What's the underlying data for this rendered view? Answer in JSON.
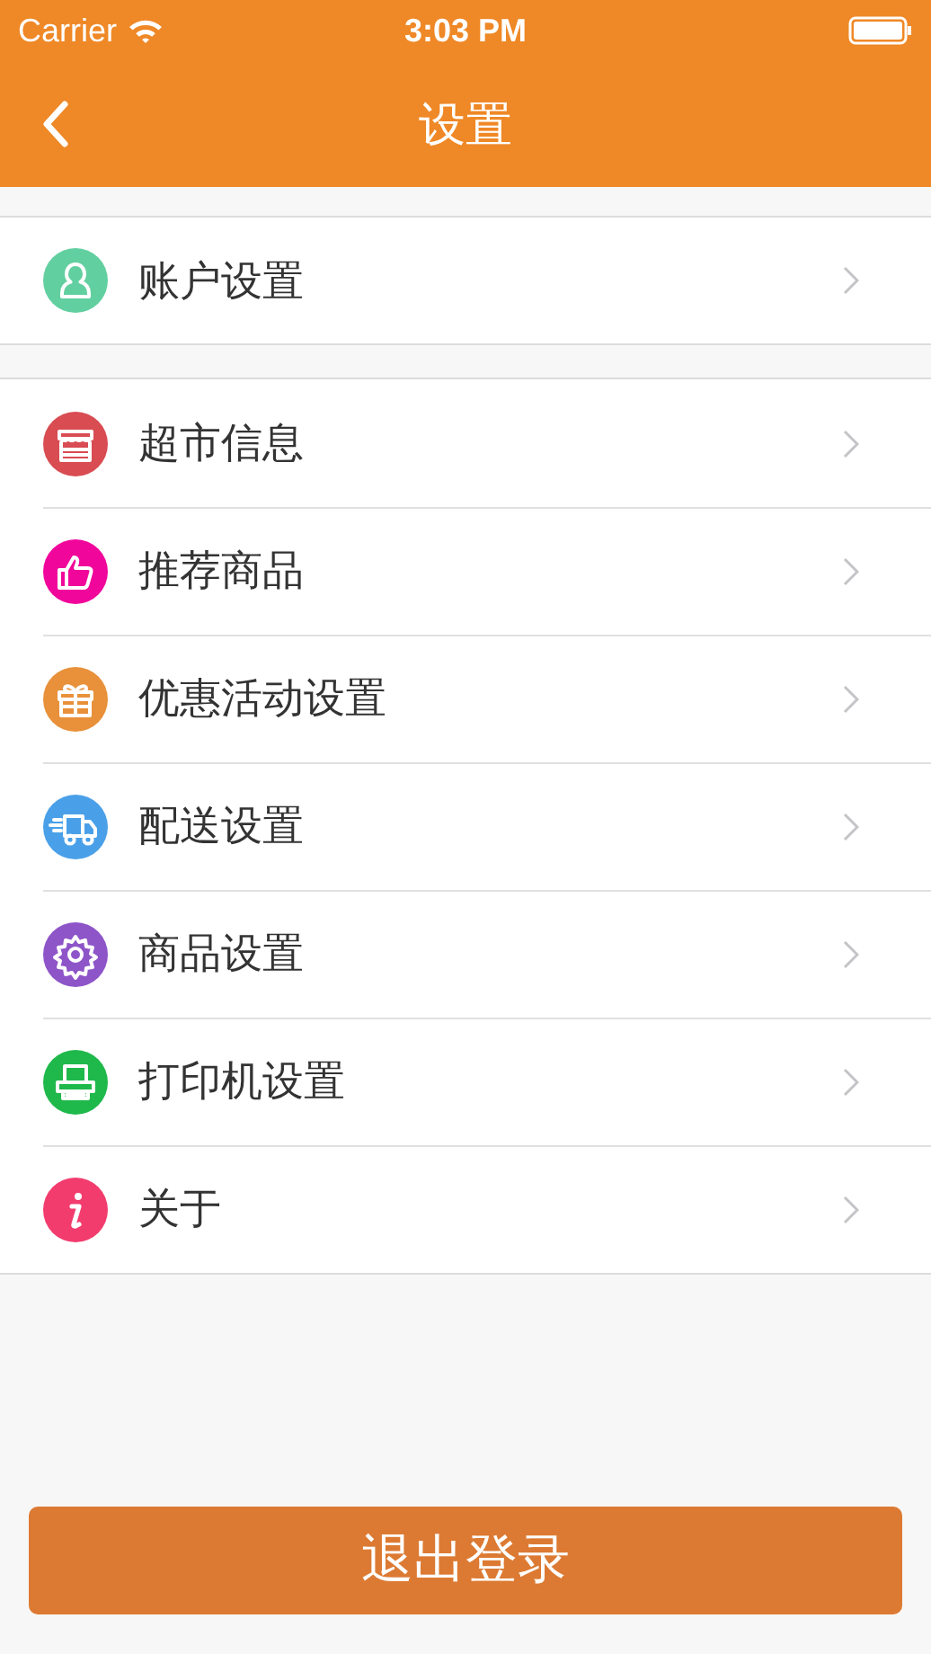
{
  "status_bar": {
    "carrier": "Carrier",
    "time": "3:03 PM"
  },
  "nav": {
    "title": "设置"
  },
  "groups": [
    {
      "items": [
        {
          "kind": "person",
          "label": "账户设置",
          "color": "#62cfa0"
        }
      ]
    },
    {
      "items": [
        {
          "kind": "store",
          "label": "超市信息",
          "color": "#d84c52"
        },
        {
          "kind": "thumb",
          "label": "推荐商品",
          "color": "#f0069b"
        },
        {
          "kind": "gift",
          "label": "优惠活动设置",
          "color": "#e8913a"
        },
        {
          "kind": "truck",
          "label": "配送设置",
          "color": "#4aa0e8"
        },
        {
          "kind": "gear",
          "label": "商品设置",
          "color": "#8e55c9"
        },
        {
          "kind": "printer",
          "label": "打印机设置",
          "color": "#1fb84b"
        },
        {
          "kind": "info",
          "label": "关于",
          "color": "#f23c6e"
        }
      ]
    }
  ],
  "logout_button": "退出登录"
}
